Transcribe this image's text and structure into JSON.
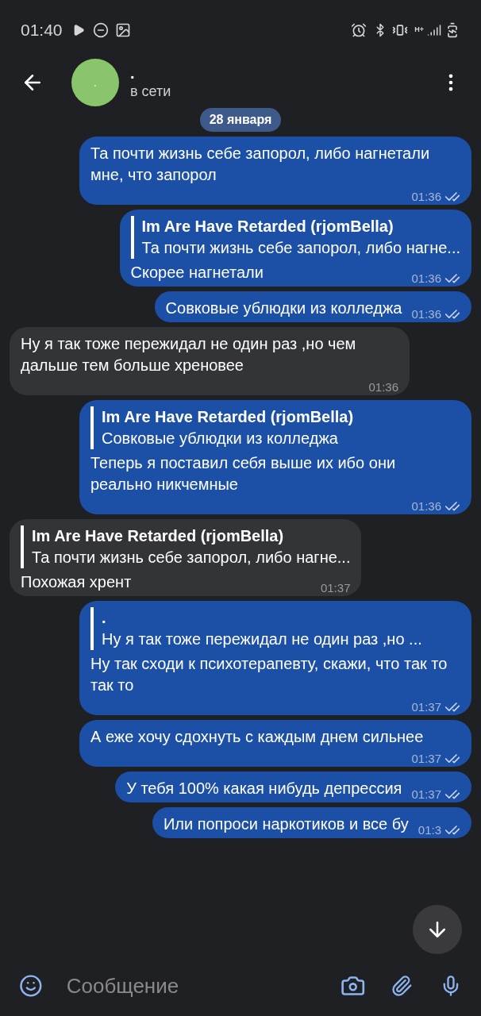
{
  "status_bar": {
    "time": "01:40",
    "network": "H+"
  },
  "header": {
    "avatar_letter": ".",
    "name": ".",
    "status": "в сети"
  },
  "date_label": "28 января",
  "messages": [
    {
      "kind": "out",
      "text": "Та почти жизнь себе запорол, либо нагнетали мне, что запорол",
      "time": "01:36",
      "read": true
    },
    {
      "kind": "out",
      "reply": {
        "author": "Im Are Have Retarded (rjomBella)",
        "text": "Та почти жизнь себе запорол, либо нагне..."
      },
      "text": "Скорее нагнетали",
      "time": "01:36",
      "read": true
    },
    {
      "kind": "out",
      "text": "Совковые ублюдки из колледжа",
      "time": "01:36",
      "read": true
    },
    {
      "kind": "in",
      "text": "Ну я так тоже пережидал не один раз ,но чем дальше тем больше хреновее",
      "time": "01:36",
      "read": false
    },
    {
      "kind": "out",
      "reply": {
        "author": "Im Are Have Retarded (rjomBella)",
        "text": "Совковые ублюдки из колледжа"
      },
      "text": "Теперь я поставил себя выше их ибо они реально никчемные",
      "time": "01:36",
      "read": true
    },
    {
      "kind": "in",
      "reply": {
        "author": "Im Are Have Retarded (rjomBella)",
        "text": "Та почти жизнь себе запорол, либо нагне..."
      },
      "text": "Похожая хрент",
      "time": "01:37",
      "read": false
    },
    {
      "kind": "out",
      "reply": {
        "author": ".",
        "text": "Ну я так тоже пережидал не один раз ,но ..."
      },
      "text": "Ну так сходи к психотерапевту, скажи, что так то так то",
      "time": "01:37",
      "read": true
    },
    {
      "kind": "out",
      "text": "А еже хочу сдохнуть с каждым днем сильнее",
      "time": "01:37",
      "read": true
    },
    {
      "kind": "out",
      "text": "У тебя 100% какая нибудь депрессия",
      "time": "01:37",
      "read": true
    },
    {
      "kind": "out",
      "text": "Или попроси наркотиков и все бу",
      "time": "01:3",
      "read": true
    }
  ],
  "composer": {
    "placeholder": "Сообщение"
  }
}
